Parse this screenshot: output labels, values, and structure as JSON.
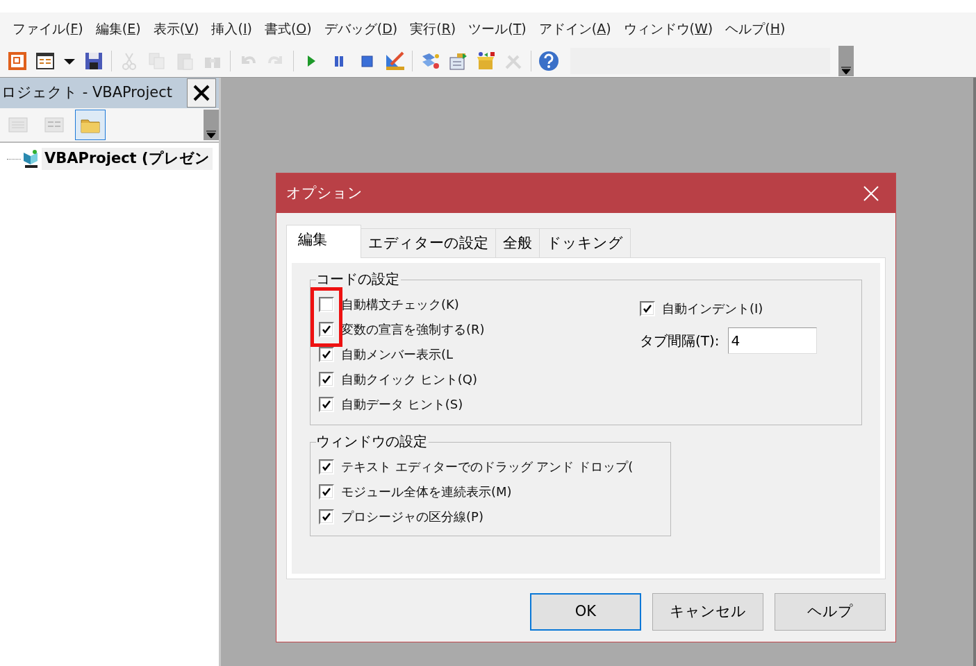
{
  "menu_bar": [
    "ファイル(F)",
    "編集(E)",
    "表示(V)",
    "挿入(I)",
    "書式(O)",
    "デバッグ(D)",
    "実行(R)",
    "ツール(T)",
    "アドイン(A)",
    "ウィンドウ(W)",
    "ヘルプ(H)"
  ],
  "toolbar": [
    {
      "disabled": false
    },
    {
      "disabled": false
    },
    {
      "disabled": false
    },
    {
      "disabled": false
    },
    {
      "disabled": true
    },
    {
      "disabled": true
    },
    {
      "disabled": true
    },
    {
      "disabled": true
    },
    {
      "disabled": true
    },
    {
      "disabled": true
    },
    {
      "disabled": false
    },
    {
      "disabled": false
    },
    {
      "disabled": false
    },
    {
      "disabled": false
    },
    {
      "disabled": false
    },
    {
      "disabled": false
    },
    {
      "disabled": false
    },
    {
      "disabled": true
    },
    {
      "disabled": false
    }
  ],
  "project_panel": {
    "title": "ロジェクト - VBAProject",
    "buttons": [
      {
        "selected": false
      },
      {
        "selected": false
      },
      {
        "selected": true
      }
    ],
    "tree": [
      {
        "label": "VBAProject (プレゼン"
      }
    ]
  },
  "dialog": {
    "title": "オプション",
    "tabs": [
      {
        "label": "編集",
        "selected": true
      },
      {
        "label": "エディターの設定",
        "selected": false
      },
      {
        "label": "全般",
        "selected": false
      },
      {
        "label": "ドッキング",
        "selected": false
      }
    ],
    "code_settings": {
      "title": "コードの設定",
      "options": [
        {
          "label": "自動構文チェック(K)",
          "checked": false
        },
        {
          "label": "変数の宣言を強制する(R)",
          "checked": true
        },
        {
          "label": "自動メンバー表示(L",
          "checked": true
        },
        {
          "label": "自動クイック ヒント(Q)",
          "checked": true
        },
        {
          "label": "自動データ ヒント(S)",
          "checked": true
        }
      ],
      "auto_indent": {
        "label": "自動インデント(I)",
        "checked": true
      },
      "tab_width": {
        "label": "タブ間隔(T):",
        "value": "4"
      }
    },
    "window_settings": {
      "title": "ウィンドウの設定",
      "options": [
        {
          "label": "テキスト エディターでのドラッグ アンド ドロップ(",
          "checked": true
        },
        {
          "label": "モジュール全体を連続表示(M)",
          "checked": true
        },
        {
          "label": "プロシージャの区分線(P)",
          "checked": true
        }
      ]
    },
    "buttons": [
      {
        "label": "OK",
        "kind": "default"
      },
      {
        "label": "キャンセル",
        "kind": "normal"
      },
      {
        "label": "ヘルプ",
        "kind": "normal"
      }
    ]
  }
}
